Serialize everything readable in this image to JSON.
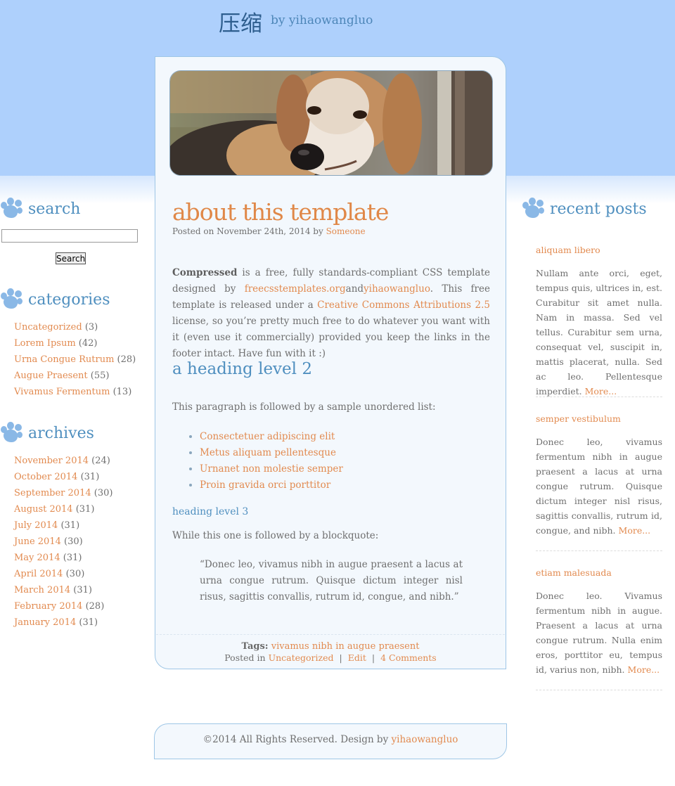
{
  "header": {
    "title": "压缩",
    "byline": "by yihaowangluo"
  },
  "sidebar_left": {
    "search": {
      "heading": "search",
      "input_value": "",
      "button_label": "Search"
    },
    "categories": {
      "heading": "categories",
      "items": [
        {
          "label": "Uncategorized",
          "count": "(3)"
        },
        {
          "label": "Lorem Ipsum",
          "count": "(42)"
        },
        {
          "label": "Urna Congue Rutrum",
          "count": "(28)"
        },
        {
          "label": "Augue Praesent",
          "count": "(55)"
        },
        {
          "label": "Vivamus Fermentum",
          "count": "(13)"
        }
      ]
    },
    "archives": {
      "heading": "archives",
      "items": [
        {
          "label": "November 2014",
          "count": "(24)"
        },
        {
          "label": "October 2014",
          "count": "(31)"
        },
        {
          "label": "September 2014",
          "count": "(30)"
        },
        {
          "label": "August 2014",
          "count": "(31)"
        },
        {
          "label": "July 2014",
          "count": "(31)"
        },
        {
          "label": "June 2014",
          "count": "(30)"
        },
        {
          "label": "May 2014",
          "count": "(31)"
        },
        {
          "label": "April 2014",
          "count": "(30)"
        },
        {
          "label": "March 2014",
          "count": "(31)"
        },
        {
          "label": "February 2014",
          "count": "(28)"
        },
        {
          "label": "January 2014",
          "count": "(31)"
        }
      ]
    }
  },
  "post": {
    "title": "about this template",
    "meta_prefix": "Posted on November 24th, 2014 by",
    "author": "Someone",
    "intro": {
      "strong": "Compressed",
      "t1": " is a free, fully standards-compliant CSS template designed by ",
      "link1": "freecsstemplates.org",
      "t2": "and",
      "link2": "yihaowangluo",
      "t3": ". This free template is released under a ",
      "link3": "Creative Commons Attributions 2.5",
      "t4": " license, so you’re pretty much free to do whatever you want with it (even use it commercially) provided you keep the links in the footer intact. Have fun with it :)"
    },
    "heading2": "a heading level 2",
    "list_intro": "This paragraph is followed by a sample unordered list:",
    "list": [
      "Consectetuer adipiscing elit",
      "Metus aliquam pellentesque",
      "Urnanet non molestie semper",
      "Proin gravida orci porttitor"
    ],
    "heading3": "heading level 3",
    "quote_intro": "While this one is followed by a blockquote:",
    "blockquote": "“Donec leo, vivamus nibh in augue praesent a lacus at urna congue rutrum. Quisque dictum integer nisl risus, sagittis convallis, rutrum id, congue, and nibh.”",
    "tags_label": "Tags:",
    "tags_value": "vivamus nibh in augue praesent",
    "posted_in_label": "Posted in",
    "category": "Uncategorized",
    "sep": "|",
    "edit": "Edit",
    "comments": "4 Comments"
  },
  "sidebar_right": {
    "heading": "recent posts",
    "more": "More...",
    "posts": [
      {
        "title": "aliquam libero",
        "body": "Nullam ante orci, eget, tempus quis, ultrices in, est. Curabitur sit amet nulla. Nam in massa. Sed vel tellus. Curabitur sem urna, consequat vel, suscipit in, mattis placerat, nulla. Sed ac leo. Pellentesque imperdiet."
      },
      {
        "title": "semper vestibulum",
        "body": "Donec leo, vivamus fermentum nibh in augue praesent a lacus at urna congue rutrum. Quisque dictum integer nisl risus, sagittis convallis, rutrum id, congue, and nibh."
      },
      {
        "title": "etiam malesuada",
        "body": "Donec leo. Vivamus fermentum nibh in augue. Praesent a lacus at urna congue rutrum. Nulla enim eros, porttitor eu, tempus id, varius non, nibh."
      }
    ]
  },
  "footer": {
    "text": "©2014 All Rights Reserved. Design by",
    "link": "yihaowangluo"
  }
}
